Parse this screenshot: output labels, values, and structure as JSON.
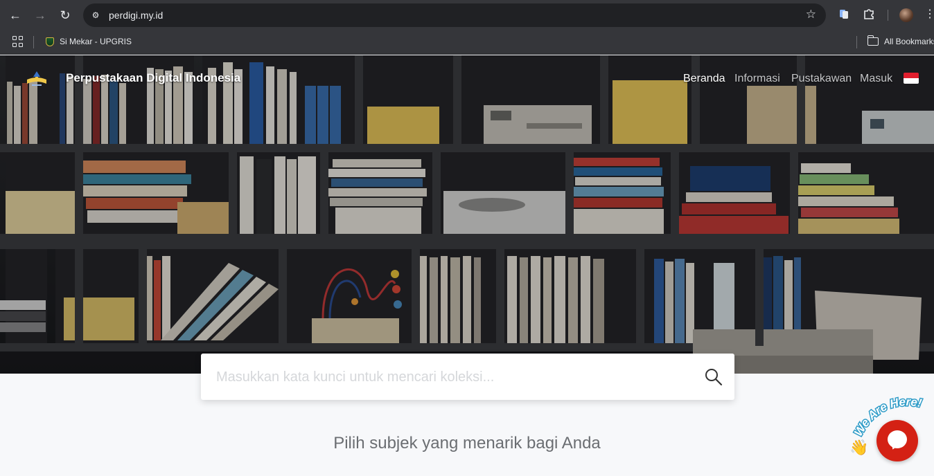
{
  "browser": {
    "url": "perdigi.my.id",
    "bookmarks": [
      {
        "label": "Si Mekar - UPGRIS"
      }
    ],
    "all_bookmarks_label": "All Bookmarks"
  },
  "site": {
    "brand_name": "Perpustakaan Digital Indonesia",
    "nav": [
      {
        "label": "Beranda",
        "active": true
      },
      {
        "label": "Informasi",
        "active": false
      },
      {
        "label": "Pustakawan",
        "active": false
      },
      {
        "label": "Masuk",
        "active": false
      }
    ],
    "language_flag": "indonesia-flag"
  },
  "search": {
    "placeholder": "Masukkan kata kunci untuk mencari koleksi..."
  },
  "section": {
    "subtitle": "Pilih subjek yang menarik bagi Anda"
  },
  "chat_widget": {
    "badge_text": "We Are Here!",
    "wave_emoji": "👋",
    "accent": "#d42114"
  },
  "colors": {
    "chrome_bg": "#35363a",
    "omnibox_bg": "#202124",
    "page_bg": "#f7f8fa"
  }
}
